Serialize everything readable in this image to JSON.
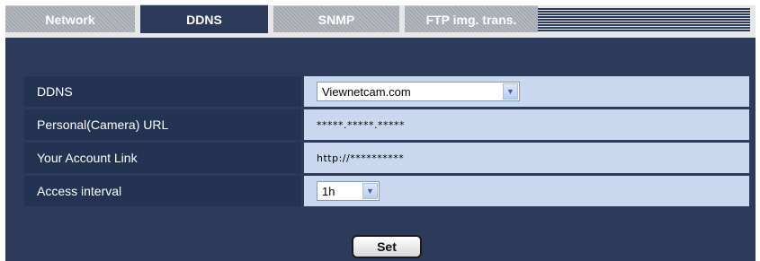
{
  "tabs": [
    {
      "label": "Network",
      "active": false
    },
    {
      "label": "DDNS",
      "active": true
    },
    {
      "label": "SNMP",
      "active": false
    },
    {
      "label": "FTP img. trans.",
      "active": false
    }
  ],
  "settings": {
    "ddns": {
      "label": "DDNS",
      "value": "Viewnetcam.com"
    },
    "personal_url": {
      "label": "Personal(Camera) URL",
      "value": "*****.*****.*****"
    },
    "account_link": {
      "label": "Your Account Link",
      "value": "http://**********"
    },
    "access_interval": {
      "label": "Access interval",
      "value": "1h"
    }
  },
  "set_button": "Set",
  "colors": {
    "panel": "#2c3b5a",
    "label_cell": "#243352",
    "value_cell": "#c9d8ee",
    "tab_inactive": "#aeb2b8"
  }
}
